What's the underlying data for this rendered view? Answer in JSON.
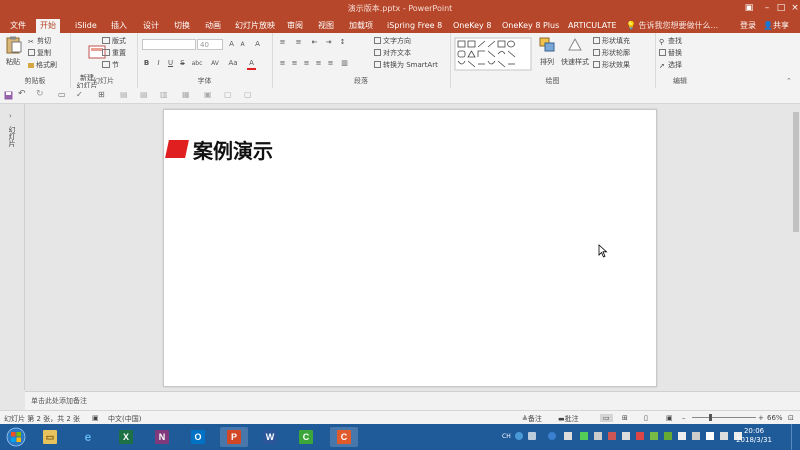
{
  "window": {
    "title": "演示版本.pptx - PowerPoint"
  },
  "tabs": [
    {
      "label": "文件"
    },
    {
      "label": "开始"
    },
    {
      "label": "iSlide"
    },
    {
      "label": "插入"
    },
    {
      "label": "设计"
    },
    {
      "label": "切换"
    },
    {
      "label": "动画"
    },
    {
      "label": "幻灯片放映"
    },
    {
      "label": "审阅"
    },
    {
      "label": "视图"
    },
    {
      "label": "加载项"
    },
    {
      "label": "iSpring Free 8"
    },
    {
      "label": "OneKey 8"
    },
    {
      "label": "OneKey 8 Plus"
    },
    {
      "label": "ARTICULATE"
    }
  ],
  "tell_me": "告诉我您想要做什么...",
  "signin": "登录",
  "share": "共享",
  "ribbon": {
    "clipboard": {
      "paste": "粘贴",
      "cut": "剪切",
      "copy": "复制",
      "format_painter": "格式刷",
      "label": "剪贴板"
    },
    "slides": {
      "new_slide": "新建\n幻灯片",
      "layout": "版式",
      "reset": "重置",
      "section": "节",
      "label": "幻灯片"
    },
    "font": {
      "size": "40",
      "label": "字体",
      "bold": "B",
      "italic": "I",
      "underline": "U",
      "strike": "S",
      "shadow": "abc",
      "spacing": "AV",
      "case": "Aa",
      "color": "A"
    },
    "paragraph": {
      "text_direction": "文字方向",
      "align_text": "对齐文本",
      "smartart": "转换为 SmartArt",
      "label": "段落"
    },
    "drawing": {
      "arrange": "排列",
      "quick_styles": "快速样式",
      "shape_fill": "形状填充",
      "shape_outline": "形状轮廓",
      "shape_effects": "形状效果",
      "label": "绘图"
    },
    "editing": {
      "find": "查找",
      "replace": "替换",
      "select": "选择",
      "label": "编辑"
    }
  },
  "slide": {
    "title": "案例演示"
  },
  "left_pane": {
    "label": "幻灯片"
  },
  "notes": {
    "placeholder": "单击此处添加备注"
  },
  "status": {
    "slide_info": "幻灯片 第 2 张，共 2 张",
    "language": "中文(中国)",
    "notes": "备注",
    "comments": "批注",
    "zoom": "66%"
  },
  "clock": {
    "time": "20:06",
    "date": "2018/3/31"
  },
  "colors": {
    "accent": "#b7472a",
    "title_mark": "#e02020",
    "taskbar": "#1f5a99"
  },
  "taskbar_apps": [
    {
      "icon": "windows-start-icon"
    },
    {
      "icon": "file-explorer-icon"
    },
    {
      "icon": "ie-icon"
    },
    {
      "icon": "excel-icon"
    },
    {
      "icon": "onenote-icon"
    },
    {
      "icon": "outlook-icon"
    },
    {
      "icon": "powerpoint-icon"
    },
    {
      "icon": "word-icon"
    },
    {
      "icon": "camtasia-icon"
    },
    {
      "icon": "camtasia-recorder-icon"
    }
  ]
}
